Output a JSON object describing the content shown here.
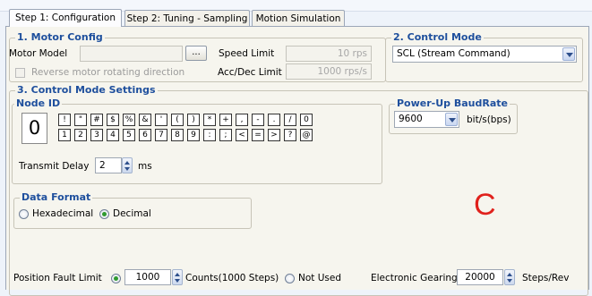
{
  "tabs": [
    {
      "label": "Step 1: Configuration",
      "active": true
    },
    {
      "label": "Step 2: Tuning - Sampling",
      "active": false
    },
    {
      "label": "Motion Simulation",
      "active": false
    }
  ],
  "motor_config": {
    "title": "1. Motor Config",
    "model_label": "Motor Model",
    "model_value": "",
    "browse_label": "...",
    "speed_limit_label": "Speed Limit",
    "speed_limit_value": "10 rps",
    "reverse_label": "Reverse motor rotating direction",
    "accdec_label": "Acc/Dec Limit",
    "accdec_value": "1000 rps/s"
  },
  "control_mode": {
    "title": "2. Control Mode",
    "selected": "SCL (Stream Command)"
  },
  "control_settings": {
    "title": "3. Control Mode Settings",
    "node_id": {
      "title": "Node ID",
      "value": "0",
      "keys_row1": [
        "!",
        "\"",
        "#",
        "$",
        "%",
        "&",
        "'",
        "(",
        ")",
        "*",
        "+",
        ",",
        "-",
        ".",
        "/",
        "0"
      ],
      "keys_row2": [
        "1",
        "2",
        "3",
        "4",
        "5",
        "6",
        "7",
        "8",
        "9",
        ":",
        ";",
        "<",
        "=",
        ">",
        "?",
        "@"
      ],
      "transmit_delay_label": "Transmit Delay",
      "transmit_delay_value": "2",
      "transmit_delay_unit": "ms"
    },
    "baudrate": {
      "title": "Power-Up BaudRate",
      "value": "9600",
      "unit": "bit/s(bps)"
    },
    "data_format": {
      "title": "Data Format",
      "options": [
        {
          "label": "Hexadecimal",
          "selected": false
        },
        {
          "label": "Decimal",
          "selected": true
        }
      ]
    },
    "annotation": "C",
    "annotation_color": "#e0211c"
  },
  "bottom": {
    "position_fault_label": "Position Fault Limit",
    "position_fault_value": "1000",
    "position_fault_unit": "Counts(1000 Steps)",
    "not_used_label": "Not Used",
    "gearing_label": "Electronic Gearing",
    "gearing_value": "20000",
    "gearing_unit": "Steps/Rev"
  }
}
